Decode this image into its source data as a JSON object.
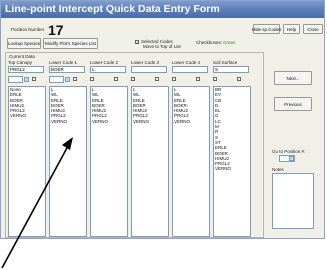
{
  "window": {
    "title": "Line-point Intercept Quick Data Entry Form",
    "position_label": "Position Number",
    "position_number": "17",
    "hide_codes": "Hide sp.Codes",
    "help": "Help",
    "close": "Close"
  },
  "toolbar": {
    "lookup_species": "Lookup Species",
    "modify_species_list": "Modify Plot's Species List",
    "selected_codes": "Selected Codes",
    "move_to_top": "Move to Top of List",
    "checkboxes_label": "Checkboxes:",
    "checkboxes_value": "Green"
  },
  "current_data": {
    "group_label": "Current Data",
    "columns": [
      {
        "header": "Top Canopy",
        "value": "PRGL2"
      },
      {
        "header": "Lower Code 1",
        "value": "BOER"
      },
      {
        "header": "Lower Code 2",
        "value": "L"
      },
      {
        "header": "Lower Code 3",
        "value": ""
      },
      {
        "header": "Lower Code 4",
        "value": ""
      },
      {
        "header": "Soil Surface",
        "value": "S"
      }
    ]
  },
  "lists": [
    [
      "None",
      "ERLE",
      "BOER",
      "HIMU2",
      "PRGL2",
      "VERNO"
    ],
    [
      "L",
      "WL",
      "ERLE",
      "BOER",
      "HIMU2",
      "PRGL2",
      "VERNO"
    ],
    [
      "L",
      "WL",
      "ERLE",
      "BOER",
      "HIMU2",
      "PRGL2",
      "VERNO"
    ],
    [
      "L",
      "WL",
      "ERLE",
      "BOER",
      "HIMU2",
      "PRGL2",
      "VERNO"
    ],
    [
      "L",
      "WL",
      "ERLE",
      "BOER-",
      "HIMU2",
      "PRGL2",
      "VERNO"
    ],
    [
      "BR",
      "EV",
      "CB",
      "D",
      "EL",
      "G",
      "LC",
      "M",
      "R",
      "S",
      "ST",
      "ERLE",
      "BOER",
      "HIMU2",
      "PRGL2",
      "VERNO"
    ]
  ],
  "side": {
    "next": "Next...",
    "previous": "Previous",
    "goto_label": "Go to Position #:",
    "notes_label": "Notes"
  }
}
